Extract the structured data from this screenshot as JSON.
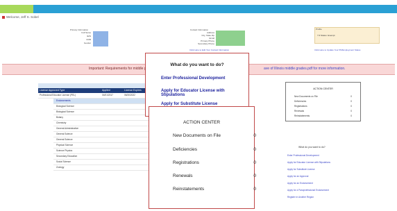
{
  "header": {
    "welcome": "Welcome, Jeff S. Sobel"
  },
  "box1": {
    "title": "Primary Information",
    "labels": [
      "Full Name",
      "IEIN",
      "DOB",
      "Gender"
    ]
  },
  "box2": {
    "title": "Contact Information",
    "labels": [
      "Address",
      "City, State Zip",
      "Email",
      "Primary Phone",
      "Secondary Phone"
    ],
    "link": "Click Here to Edit Your Contact Information"
  },
  "box3": {
    "title": "Profile",
    "value": "Y:3 Status: Exempt",
    "link": "Click Here to Update Your PD/Employment Status"
  },
  "banner": {
    "text": "Important: Requirements for middle grade",
    "link_text": "ave of Illinois middle grades.pdf for more information."
  },
  "table": {
    "headers": [
      "License Approved Type",
      "Applied",
      "License Expires"
    ],
    "rows": [
      {
        "type": "Professional Educator License (PEL)",
        "applied": "04/01/2017",
        "expires": "06/30/2022"
      }
    ],
    "endorsements_label": "Endorsements",
    "endorsements": [
      "Biological Science",
      "Biological Science",
      "Botany",
      "Chemistry",
      "General Administrative",
      "General Science",
      "General Science",
      "Physical Science",
      "Science Physics",
      "Secondary Education",
      "Social Science",
      "Zoology"
    ]
  },
  "popup": {
    "title": "What do you want to do?",
    "links": [
      "Enter Professional Development",
      "Apply for Educator License with Stipulations",
      "Apply for Substitute License"
    ]
  },
  "action_center": {
    "title": "ACTION CENTER",
    "items": [
      {
        "label": "New Documents on File",
        "count": "0"
      },
      {
        "label": "Deficiencies",
        "count": "0"
      },
      {
        "label": "Registrations",
        "count": "0"
      },
      {
        "label": "Renewals",
        "count": "0"
      },
      {
        "label": "Reinstatements",
        "count": "0"
      }
    ]
  },
  "side_action_center": {
    "title": "ACTION CENTER",
    "items": [
      {
        "label": "New Documents on File",
        "count": "0"
      },
      {
        "label": "Deficiencies",
        "count": "0"
      },
      {
        "label": "Registrations",
        "count": "0"
      },
      {
        "label": "Renewals",
        "count": "0"
      },
      {
        "label": "Reinstatements",
        "count": "0"
      }
    ]
  },
  "side_menu": {
    "question": "What do you want to do?",
    "links": [
      "Enter Professional Development",
      "Apply for Educator License with Stipulations",
      "Apply for Substitute License",
      "Apply for an Approval",
      "Apply for an Endorsement",
      "Apply for a Paraprofessional Endorsement",
      "Register in Another Region"
    ]
  }
}
